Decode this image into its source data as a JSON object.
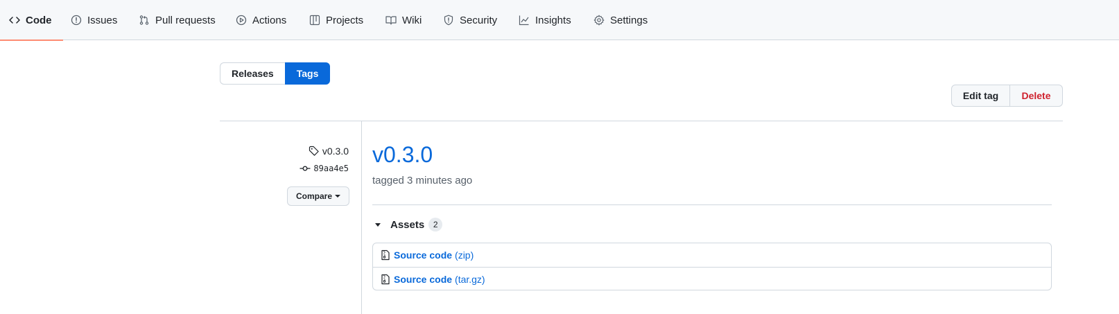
{
  "nav": {
    "items": [
      {
        "label": "Code",
        "icon": "code-icon",
        "selected": true
      },
      {
        "label": "Issues",
        "icon": "issue-opened-icon"
      },
      {
        "label": "Pull requests",
        "icon": "git-pull-request-icon"
      },
      {
        "label": "Actions",
        "icon": "play-icon"
      },
      {
        "label": "Projects",
        "icon": "table-icon"
      },
      {
        "label": "Wiki",
        "icon": "book-icon"
      },
      {
        "label": "Security",
        "icon": "shield-icon"
      },
      {
        "label": "Insights",
        "icon": "graph-icon"
      },
      {
        "label": "Settings",
        "icon": "gear-icon"
      }
    ],
    "accent": "#fd8c73"
  },
  "subnav": {
    "releases_label": "Releases",
    "tags_label": "Tags"
  },
  "actions": {
    "edit_label": "Edit tag",
    "delete_label": "Delete"
  },
  "tag": {
    "name": "v0.3.0",
    "commit": "89aa4e5",
    "compare_label": "Compare",
    "title": "v0.3.0",
    "tagged": "tagged 3 minutes ago"
  },
  "assets": {
    "label": "Assets",
    "count": "2",
    "items": [
      {
        "name": "Source code",
        "ext": "(zip)",
        "icon": "file-zip-icon"
      },
      {
        "name": "Source code",
        "ext": "(tar.gz)",
        "icon": "file-zip-icon"
      }
    ]
  },
  "colors": {
    "link": "#0969da",
    "danger": "#cf222e",
    "border": "#d0d7de"
  }
}
